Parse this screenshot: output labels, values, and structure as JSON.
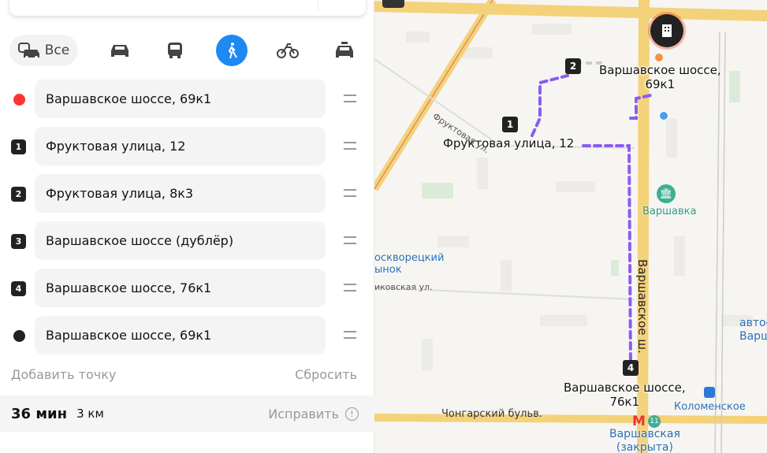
{
  "modes": {
    "all_label": "Все",
    "items": [
      "car",
      "bus",
      "pedestrian",
      "bicycle",
      "taxi"
    ],
    "active": "pedestrian"
  },
  "waypoints": [
    {
      "marker": "",
      "address": "Варшавское шоссе, 69к1",
      "type": "start"
    },
    {
      "marker": "1",
      "address": "Фруктовая улица, 12"
    },
    {
      "marker": "2",
      "address": "Фруктовая улица, 8к3"
    },
    {
      "marker": "3",
      "address": "Варшавское шоссе (дублёр)"
    },
    {
      "marker": "4",
      "address": "Варшавское шоссе, 76к1"
    },
    {
      "marker": "",
      "address": "Варшавское шоссе, 69к1",
      "type": "end"
    }
  ],
  "actions": {
    "add_point": "Добавить точку",
    "reset": "Сбросить"
  },
  "summary": {
    "time": "36 мин",
    "distance": "3 км",
    "fix": "Исправить"
  },
  "map": {
    "labels": {
      "start": "Варшавское шоссе,\n69к1",
      "p1": "Фруктовая улица, 12",
      "p4": "Варшавское шоссе,\n76к1",
      "street_fruit": "Фруктовая ул.",
      "street_var": "Варшавское ш.",
      "street_kik": "иковская ул.",
      "street_chong": "Чонгарский бульв.",
      "poi_market": "осквoрецкий\nынок",
      "poi_varshavka": "Варшавка",
      "poi_kolom": "Коломенское",
      "poi_metro": "Варшавская\n(закрыта)",
      "poi_bus": "автос\nВарш",
      "metro_line": "11"
    },
    "nums": [
      "1",
      "2",
      "4"
    ],
    "route_color": "#8a5cf5",
    "accent": "#1e88f3"
  }
}
